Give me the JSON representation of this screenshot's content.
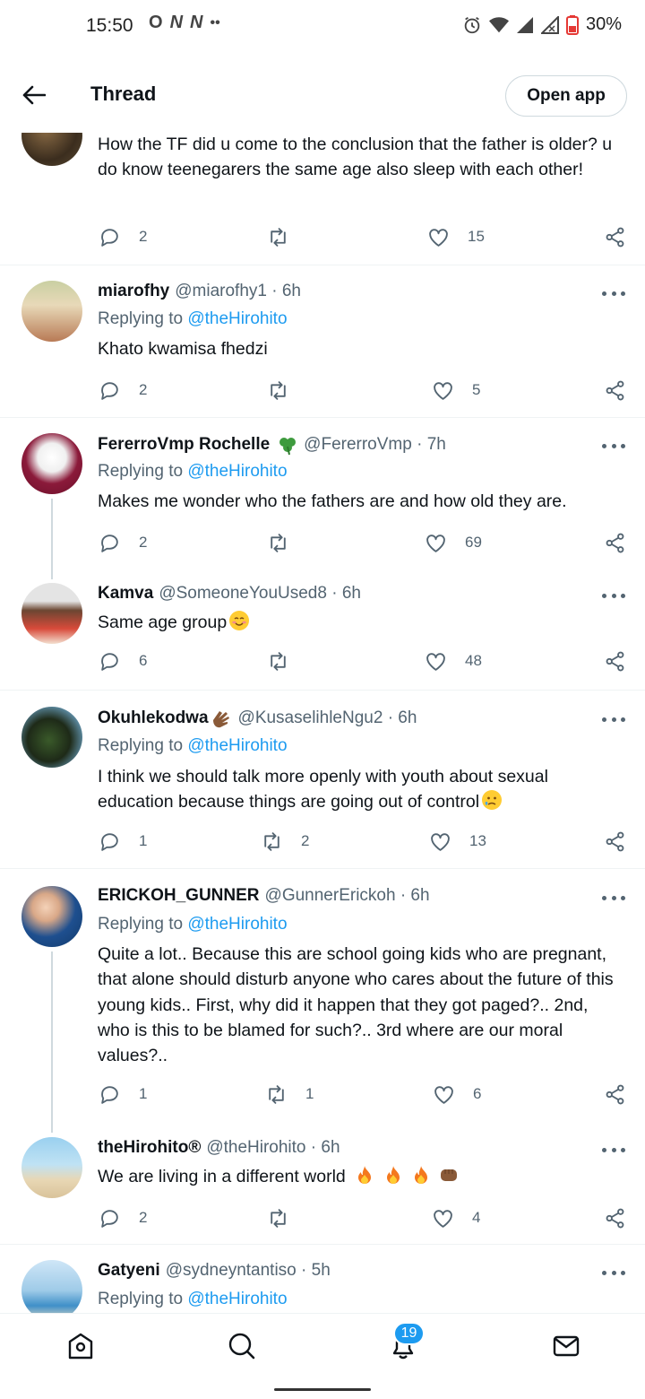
{
  "status_bar": {
    "time": "15:50",
    "notification_icons": [
      "O",
      "N",
      "N"
    ],
    "overflow_dots": "••",
    "battery": "30%"
  },
  "header": {
    "title": "Thread",
    "open_app_label": "Open app"
  },
  "tweets": [
    {
      "body": "How the TF did u come to the conclusion that the father is older? u do know teenegarers the same age also sleep with each other!",
      "replies": "2",
      "retweets": "",
      "likes": "15"
    },
    {
      "name": "miarofhy",
      "handle": "@miarofhy1 · 6h",
      "replying_prefix": "Replying to",
      "replying_to": "@theHirohito",
      "body": "Khato kwamisa fhedzi",
      "replies": "2",
      "retweets": "",
      "likes": "5"
    },
    {
      "name": "FererroVmp Rochelle",
      "handle": "@FererroVmp · 7h",
      "replying_prefix": "Replying to",
      "replying_to": "@theHirohito",
      "body": "Makes me wonder who the fathers are and how old they are.",
      "replies": "2",
      "retweets": "",
      "likes": "69"
    },
    {
      "name": "Kamva",
      "handle": "@SomeoneYouUsed8 · 6h",
      "body": "Same age group",
      "replies": "6",
      "retweets": "",
      "likes": "48"
    },
    {
      "name": "Okuhlekodwa",
      "handle": "@KusaselihleNgu2 · 6h",
      "replying_prefix": "Replying to",
      "replying_to": "@theHirohito",
      "body": "I think we should talk more openly with youth about sexual education because things are going out of control",
      "replies": "1",
      "retweets": "2",
      "likes": "13"
    },
    {
      "name": "ERICKOH_GUNNER",
      "handle": "@GunnerErickoh · 6h",
      "replying_prefix": "Replying to",
      "replying_to": "@theHirohito",
      "body": "Quite a lot.. Because this are school going kids who are pregnant, that alone should disturb anyone who cares about the future of this young kids.. First, why did it happen that they got paged?.. 2nd, who is this to be blamed for such?.. 3rd where are our moral values?..",
      "replies": "1",
      "retweets": "1",
      "likes": "6"
    },
    {
      "name": "theHirohito®",
      "handle": "@theHirohito · 6h",
      "body": "We are living in a different world",
      "replies": "2",
      "retweets": "",
      "likes": "4"
    },
    {
      "name": "Gatyeni",
      "handle": "@sydneyntantiso · 5h",
      "replying_prefix": "Replying to",
      "replying_to": "@theHirohito"
    }
  ],
  "bottom_nav": {
    "notifications_badge": "19"
  },
  "colors": {
    "accent": "#1d9bf0",
    "secondary_text": "#536471",
    "divider": "#eff3f4"
  }
}
